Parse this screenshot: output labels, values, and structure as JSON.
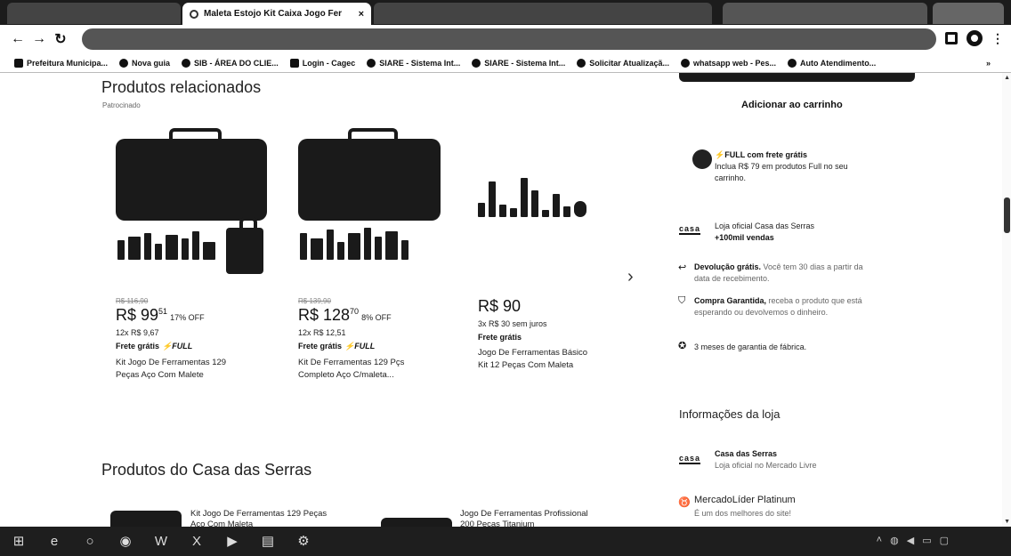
{
  "browser": {
    "active_tab_title": "Maleta Estojo Kit Caixa Jogo Fer",
    "tab_close": "×",
    "nav": {
      "back": "←",
      "forward": "→",
      "reload": "↻"
    },
    "bookmarks": [
      {
        "label": "Prefeitura Municipa..."
      },
      {
        "label": "Nova guia"
      },
      {
        "label": "SIB - ÁREA DO CLIE..."
      },
      {
        "label": "Login - Cagec"
      },
      {
        "label": "SIARE - Sistema Int..."
      },
      {
        "label": "SIARE - Sistema Int..."
      },
      {
        "label": "Solicitar Atualizaçã..."
      },
      {
        "label": "whatsapp web - Pes..."
      },
      {
        "label": "Auto Atendimento..."
      }
    ],
    "bookmarks_more": "»"
  },
  "related": {
    "heading": "Produtos relacionados",
    "subheading": "Patrocinado",
    "next_label": "›",
    "products": [
      {
        "old_price": "R$ 116,90",
        "price_int": "R$ 99",
        "price_cents": "51",
        "off": "17% OFF",
        "installments": "12x R$ 9,67",
        "shipping": "Frete grátis",
        "full_badge": "⚡FULL",
        "title_line1": "Kit Jogo De Ferramentas 129",
        "title_line2": "Peças Aço Com Malete"
      },
      {
        "old_price": "R$ 139,90",
        "price_int": "R$ 128",
        "price_cents": "70",
        "off": "8% OFF",
        "installments": "12x R$ 12,51",
        "shipping": "Frete grátis",
        "full_badge": "⚡FULL",
        "title_line1": "Kit De Ferramentas 129 Pçs",
        "title_line2": "Completo Aço C/maleta..."
      },
      {
        "old_price": "",
        "price_int": "R$ 90",
        "price_cents": "",
        "off": "",
        "installments": "3x R$ 30 sem juros",
        "shipping": "Frete grátis",
        "full_badge": "",
        "title_line1": "Jogo De Ferramentas Básico",
        "title_line2": "Kit 12 Peças Com Maleta"
      }
    ]
  },
  "sidebar": {
    "add_to_cart": "Adicionar ao carrinho",
    "full_title": "⚡FULL com frete grátis",
    "full_desc_1": "Inclua R$ 79 em produtos Full no seu",
    "full_desc_2": "carrinho.",
    "store_logo": "casa",
    "store_official": "Loja oficial Casa das Serras",
    "store_sales": "+100mil vendas",
    "returns_bold": "Devolução grátis.",
    "returns_text_1": " Você tem 30 dias a partir da",
    "returns_text_2": "data de recebimento.",
    "guarantee_bold": "Compra Garantida,",
    "guarantee_text_1": " receba o produto que está",
    "guarantee_text_2": "esperando ou devolvemos o dinheiro.",
    "warranty": "3 meses de garantia de fábrica.",
    "store_info_heading": "Informações da loja",
    "store_name": "Casa das Serras",
    "store_sub": "Loja oficial no Mercado Livre",
    "leader_title": "MercadoLíder Platinum",
    "leader_sub": "É um dos melhores do site!"
  },
  "seller_products": {
    "heading": "Produtos do Casa das Serras",
    "items": [
      {
        "title_line1": "Kit Jogo De Ferramentas 129 Peças",
        "title_line2": "Aço Com Maleta"
      },
      {
        "title_line1": "Jogo De Ferramentas Profissional",
        "title_line2": "200 Peças Titanium"
      }
    ]
  },
  "taskbar": {
    "icons": [
      "windows-icon",
      "edge-icon",
      "cortana-icon",
      "chrome-icon",
      "word-icon",
      "excel-icon",
      "media-icon",
      "explorer-icon",
      "settings-icon"
    ]
  }
}
